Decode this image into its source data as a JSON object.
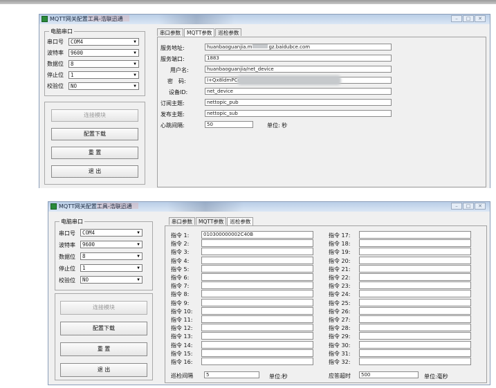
{
  "w1": {
    "title": "MQTT网关配置工具-浩联迅通",
    "serial": {
      "group_title": "电脑串口",
      "port_label": "串口号",
      "port_value": "COM4",
      "baud_label": "波特率",
      "baud_value": "9600",
      "data_label": "数据位",
      "data_value": "8",
      "stop_label": "停止位",
      "stop_value": "1",
      "parity_label": "校验位",
      "parity_value": "NO"
    },
    "buttons": {
      "connect": "连接模块",
      "download": "配置下载",
      "reset": "重 置",
      "exit": "退 出"
    },
    "tabs": [
      "串口参数",
      "MQTT参数",
      "巡检参数"
    ],
    "mqtt": {
      "server_label": "服务地址:",
      "server_value": "huanbaoguanjia.m",
      "server_value_tail": "gz.baidubce.com",
      "port_label": "服务端口:",
      "port_value": "1883",
      "user_label": "用户名:",
      "user_value": "huanbaoguanjia/net_device",
      "pwd_label": "密　码:",
      "pwd_value": "I+Qx8ldmPCoyI",
      "device_label": "设备ID:",
      "device_value": "net_device",
      "sub_label": "订阅主题:",
      "sub_value": "nettopic_pub",
      "pub_label": "发布主题:",
      "pub_value": "nettopic_sub",
      "heartbeat_label": "心跳间隔:",
      "heartbeat_value": "50",
      "heartbeat_unit": "单位: 秒"
    }
  },
  "w2": {
    "title": "MQTT网关配置工具-浩联迅通",
    "serial": {
      "group_title": "电脑串口",
      "port_label": "串口号",
      "port_value": "COM4",
      "baud_label": "波特率",
      "baud_value": "9600",
      "data_label": "数据位",
      "data_value": "8",
      "stop_label": "停止位",
      "stop_value": "1",
      "parity_label": "校验位",
      "parity_value": "NO"
    },
    "buttons": {
      "connect": "连接模块",
      "download": "配置下载",
      "reset": "重 置",
      "exit": "退 出"
    },
    "tabs": [
      "串口参数",
      "MQTT参数",
      "巡检参数"
    ],
    "commands_left": [
      {
        "label": "指令 1:",
        "value": "010300000002C40B"
      },
      {
        "label": "指令 2:",
        "value": ""
      },
      {
        "label": "指令 3:",
        "value": ""
      },
      {
        "label": "指令 4:",
        "value": ""
      },
      {
        "label": "指令 5:",
        "value": ""
      },
      {
        "label": "指令 6:",
        "value": ""
      },
      {
        "label": "指令 7:",
        "value": ""
      },
      {
        "label": "指令 8:",
        "value": ""
      },
      {
        "label": "指令 9:",
        "value": ""
      },
      {
        "label": "指令 10:",
        "value": ""
      },
      {
        "label": "指令 11:",
        "value": ""
      },
      {
        "label": "指令 12:",
        "value": ""
      },
      {
        "label": "指令 13:",
        "value": ""
      },
      {
        "label": "指令 14:",
        "value": ""
      },
      {
        "label": "指令 15:",
        "value": ""
      },
      {
        "label": "指令 16:",
        "value": ""
      }
    ],
    "commands_right": [
      {
        "label": "指令 17:",
        "value": ""
      },
      {
        "label": "指令 18:",
        "value": ""
      },
      {
        "label": "指令 19:",
        "value": ""
      },
      {
        "label": "指令 20:",
        "value": ""
      },
      {
        "label": "指令 21:",
        "value": ""
      },
      {
        "label": "指令 22:",
        "value": ""
      },
      {
        "label": "指令 23:",
        "value": ""
      },
      {
        "label": "指令 24:",
        "value": ""
      },
      {
        "label": "指令 25:",
        "value": ""
      },
      {
        "label": "指令 26:",
        "value": ""
      },
      {
        "label": "指令 27:",
        "value": ""
      },
      {
        "label": "指令 28:",
        "value": ""
      },
      {
        "label": "指令 29:",
        "value": ""
      },
      {
        "label": "指令 30:",
        "value": ""
      },
      {
        "label": "指令 31:",
        "value": ""
      },
      {
        "label": "指令 32:",
        "value": ""
      }
    ],
    "bottom": {
      "interval_label": "巡检间隔",
      "interval_value": "5",
      "interval_unit": "单位:秒",
      "timeout_label": "应答超时",
      "timeout_value": "500",
      "timeout_unit": "单位:毫秒"
    }
  }
}
